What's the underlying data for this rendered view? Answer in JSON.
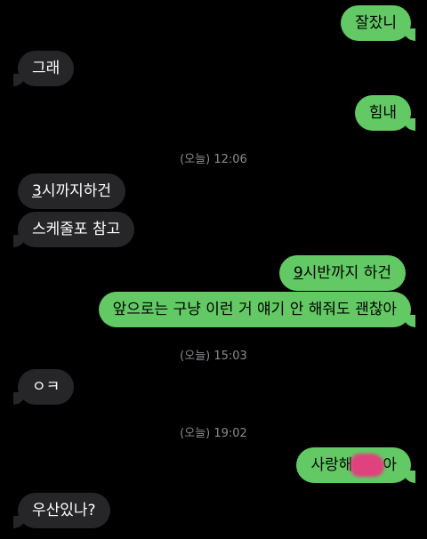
{
  "messages": [
    {
      "side": "sent",
      "text": "잘잤니"
    },
    {
      "side": "recv",
      "text": "그래"
    },
    {
      "side": "sent",
      "text": "힘내"
    },
    {
      "side": "recv",
      "text_num": "3",
      "text_rest": "시까지하건"
    },
    {
      "side": "recv",
      "text": "스케줄포 참고"
    },
    {
      "side": "sent",
      "text_num": "9",
      "text_rest": "시반까지 하건"
    },
    {
      "side": "sent",
      "text": "앞으로는 구냥 이런 거 얘기 안 해줘도 괜찮아"
    },
    {
      "side": "recv",
      "text": "ㅇㅋ"
    },
    {
      "side": "sent",
      "text_before": "사랑해",
      "text_after": "아"
    },
    {
      "side": "recv",
      "text": "우산있나?"
    }
  ],
  "timestamps": [
    "(오늘) 12:06",
    "(오늘) 15:03",
    "(오늘) 19:02"
  ],
  "colors": {
    "sent": "#63c964",
    "received": "#262628",
    "background": "#000000",
    "timestamp": "#8a8a8e"
  }
}
